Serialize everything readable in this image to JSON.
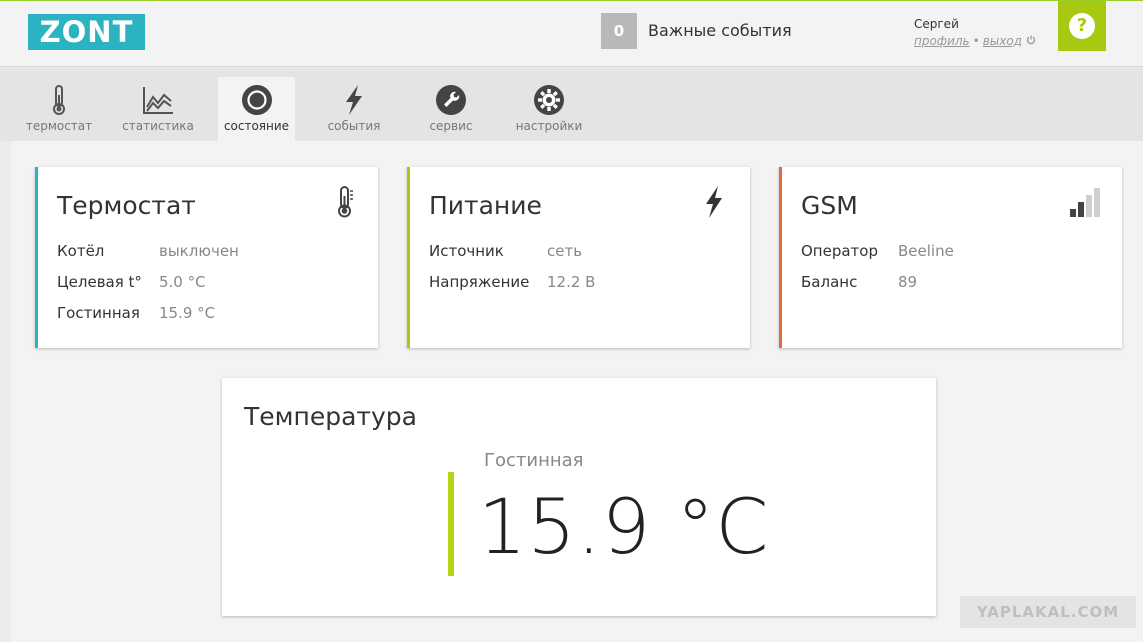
{
  "header": {
    "logo_text": "ZONT",
    "events_count": "0",
    "events_label": "Важные события",
    "user_name": "Сергей",
    "profile_link": "профиль",
    "separator": "•",
    "logout_link": "выход",
    "help_symbol": "?"
  },
  "tabs": [
    {
      "label": "термостат",
      "icon": "thermometer-icon"
    },
    {
      "label": "статистика",
      "icon": "chart-icon"
    },
    {
      "label": "состояние",
      "icon": "status-circle-icon",
      "active": true
    },
    {
      "label": "события",
      "icon": "lightning-icon"
    },
    {
      "label": "сервис",
      "icon": "wrench-icon"
    },
    {
      "label": "настройки",
      "icon": "gear-icon"
    }
  ],
  "cards": {
    "thermostat": {
      "title": "Термостат",
      "accent": "#2ab3c1",
      "rows": [
        {
          "label": "Котёл",
          "value": "выключен"
        },
        {
          "label": "Целевая t°",
          "value": "5.0 °C"
        },
        {
          "label": "Гостинная",
          "value": "15.9 °C"
        }
      ]
    },
    "power": {
      "title": "Питание",
      "accent": "#a8c912",
      "rows": [
        {
          "label": "Источник",
          "value": "сеть"
        },
        {
          "label": "Напряжение",
          "value": "12.2 В"
        }
      ]
    },
    "gsm": {
      "title": "GSM",
      "accent": "#e06a3a",
      "signal_bars_active": 2,
      "signal_bars_total": 4,
      "rows": [
        {
          "label": "Оператор",
          "value": "Beeline"
        },
        {
          "label": "Баланс",
          "value": "89"
        }
      ]
    }
  },
  "temperature": {
    "title": "Температура",
    "room": "Гостинная",
    "value": "15.9 °C"
  },
  "watermark": "YAPLAKAL.COM"
}
